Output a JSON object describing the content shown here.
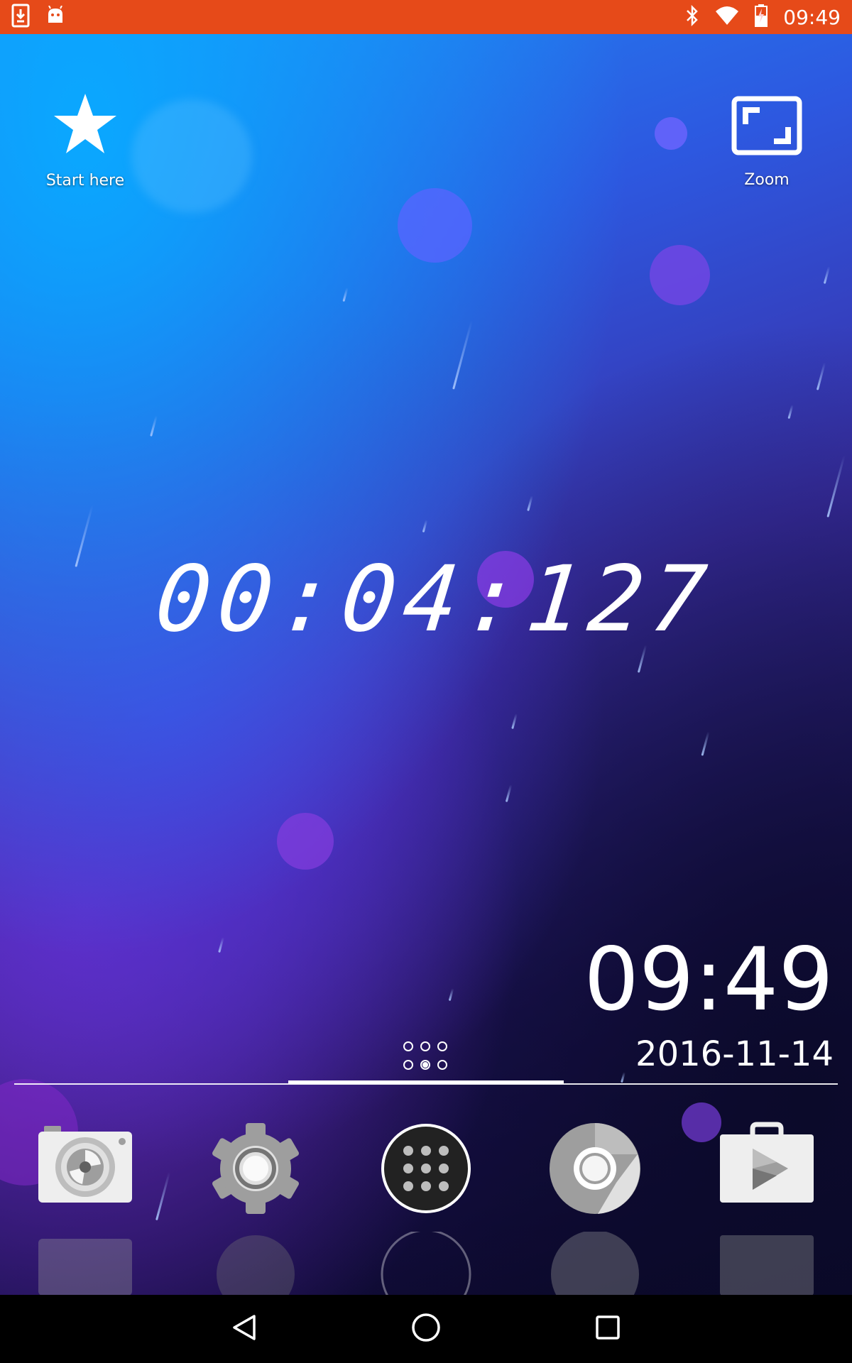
{
  "status_bar": {
    "time": "09:49",
    "left_icons": [
      "download-icon",
      "android-icon"
    ],
    "right_icons": [
      "bluetooth-icon",
      "wifi-icon",
      "battery-charging-icon"
    ],
    "background_color": "#e64a19"
  },
  "shortcuts": {
    "start_here": {
      "label": "Start here",
      "icon": "star-icon"
    },
    "zoom": {
      "label": "Zoom",
      "icon": "zoom-fullscreen-icon"
    }
  },
  "stopwatch": {
    "value": "00:04:127"
  },
  "clock_widget": {
    "time": "09:49",
    "date": "2016-11-14"
  },
  "page_indicator": {
    "pages": 6,
    "active_index": 4
  },
  "dock": {
    "apps": [
      {
        "name": "Camera",
        "icon": "camera-icon"
      },
      {
        "name": "Settings",
        "icon": "settings-gear-icon"
      },
      {
        "name": "Apps",
        "icon": "app-drawer-icon"
      },
      {
        "name": "Chrome",
        "icon": "chrome-icon"
      },
      {
        "name": "Play Store",
        "icon": "play-store-icon"
      }
    ]
  },
  "nav_bar": {
    "buttons": [
      "back-icon",
      "home-icon",
      "recents-icon"
    ]
  }
}
